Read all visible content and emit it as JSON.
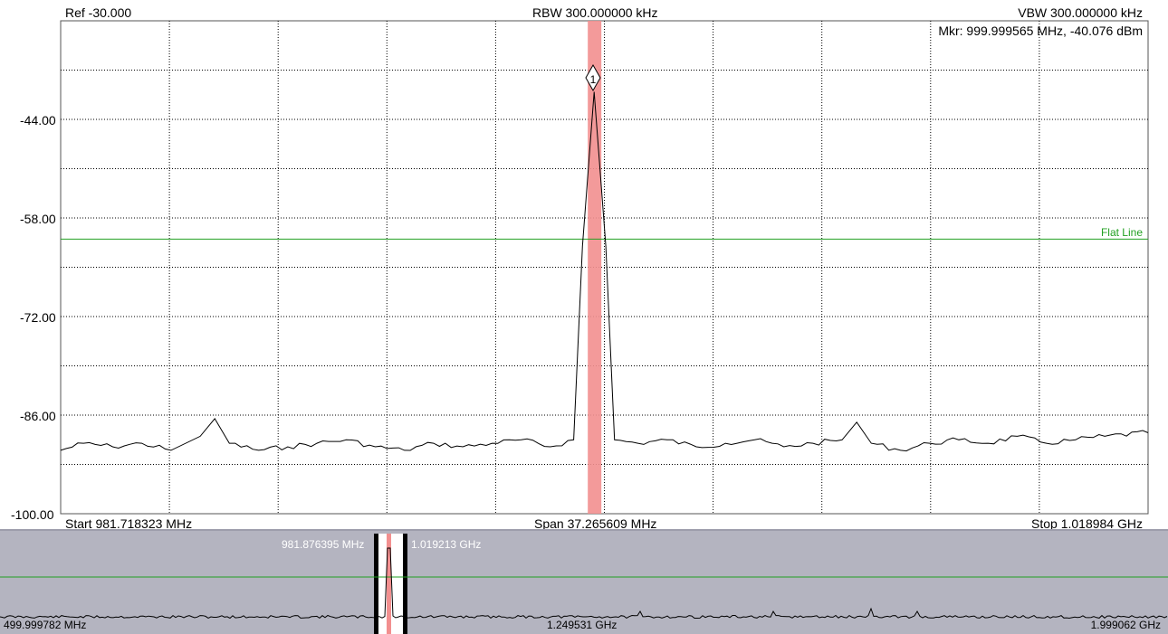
{
  "header": {
    "ref": "Ref -30.000",
    "rbw": "RBW 300.000000 kHz",
    "vbw": "VBW 300.000000 kHz",
    "marker_readout": "Mkr: 999.999565 MHz, -40.076 dBm"
  },
  "footer": {
    "start": "Start 981.718323 MHz",
    "span": "Span 37.265609 MHz",
    "stop": "Stop 1.018984 GHz"
  },
  "y_axis": {
    "ticks": [
      "-44.00",
      "-58.00",
      "-72.00",
      "-86.00",
      "-100.00"
    ]
  },
  "flat_line": {
    "label": "Flat Line",
    "level_dbm": -61
  },
  "marker": {
    "label": "1",
    "freq_mhz": 999.999565,
    "level_dbm": -40.076
  },
  "overview": {
    "left_freq": "499.999782 MHz",
    "center_freq": "1.249531 GHz",
    "right_freq": "1.999062 GHz",
    "window_start": "981.876395 MHz",
    "window_stop": "1.019213 GHz"
  },
  "colors": {
    "trace": "#000000",
    "grid": "#000000",
    "flat_line": "#22a022",
    "marker_band": "#f08080",
    "overview_bg": "#b4b4c0",
    "overview_text": "#ffffff"
  },
  "chart_data": {
    "type": "line",
    "x_range_mhz": [
      981.718323,
      1018.984
    ],
    "ylim": [
      -100,
      -30
    ],
    "grid": true,
    "series": [
      {
        "values_mhz": [
          981.718,
          982.5,
          983.5,
          984.5,
          985.5,
          986.5,
          987.0,
          987.5,
          988.5,
          989.5,
          990.5,
          991.5,
          992.5,
          993.5,
          994.5,
          995.5,
          996.5,
          997.5,
          998.5,
          999.3,
          999.6,
          1000.0,
          1000.4,
          1000.7,
          1001.5,
          1002.5,
          1003.5,
          1004.5,
          1005.5,
          1006.5,
          1007.5,
          1008.5,
          1009.0,
          1009.5,
          1010.5,
          1011.5,
          1012.5,
          1013.5,
          1014.5,
          1015.5,
          1016.5,
          1017.5,
          1018.984
        ],
        "values_dbm": [
          -91,
          -90,
          -90.5,
          -90,
          -91,
          -89,
          -86.5,
          -90,
          -91,
          -90.5,
          -90,
          -89.5,
          -90.5,
          -91,
          -90,
          -90.5,
          -90,
          -89.5,
          -90.5,
          -89.5,
          -62,
          -40.1,
          -62,
          -89.5,
          -90,
          -89.5,
          -90.5,
          -90,
          -89.5,
          -90.5,
          -90,
          -89.5,
          -87,
          -90,
          -91,
          -90,
          -89.5,
          -90,
          -89,
          -90,
          -89.5,
          -89,
          -88.5
        ]
      }
    ]
  }
}
